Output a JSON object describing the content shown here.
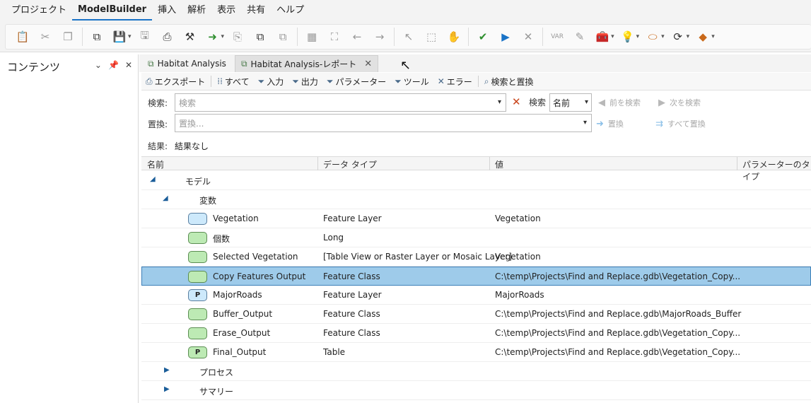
{
  "menu": {
    "items": [
      "プロジェクト",
      "ModelBuilder",
      "挿入",
      "解析",
      "表示",
      "共有",
      "ヘルプ"
    ],
    "active_index": 1
  },
  "ribbon": {
    "icons": [
      "paste-icon",
      "cut-icon",
      "copy-icon",
      "model-icon",
      "save-icon",
      "save-as-icon",
      "export-icon",
      "properties-icon",
      "tools-icon",
      "run-arrow-icon",
      "report-icon",
      "model-group-icon",
      "layout-icon",
      "auto-layout-icon",
      "fit-icon",
      "previous-icon",
      "next-icon",
      "select-icon",
      "select-all-icon",
      "pan-icon",
      "validate-icon",
      "run-icon",
      "stop-icon",
      "variable-icon",
      "edit-icon",
      "toolbox-icon",
      "lightbulb-icon",
      "label-icon",
      "iterator-icon",
      "utilities-icon"
    ]
  },
  "contents_panel": {
    "title": "コンテンツ"
  },
  "tabs": [
    {
      "label": "Habitat Analysis",
      "active": false
    },
    {
      "label": "Habitat Analysis-レポート",
      "active": true
    }
  ],
  "report_toolbar": {
    "export": "エクスポート",
    "all": "すべて",
    "input": "入力",
    "output": "出力",
    "parameter": "パラメーター",
    "tool": "ツール",
    "error": "エラー",
    "find_replace": "検索と置換"
  },
  "search": {
    "search_label": "検索:",
    "search_placeholder": "検索",
    "search_button": "検索",
    "search_by": "名前",
    "prev": "前を検索",
    "next": "次を検索",
    "replace_label": "置換:",
    "replace_placeholder": "置換...",
    "replace_button": "置換",
    "replace_all": "すべて置換",
    "result_label": "結果:",
    "result_value": "結果なし"
  },
  "grid": {
    "columns": [
      "名前",
      "データ タイプ",
      "値",
      "パラメーターのタイプ"
    ],
    "model_label": "モデル",
    "variables_label": "変数",
    "rows": [
      {
        "name": "Vegetation",
        "type": "Feature Layer",
        "value": "Vegetation",
        "badge": "",
        "color": "blue",
        "selected": false
      },
      {
        "name": "個数",
        "type": "Long",
        "value": "",
        "badge": "",
        "color": "green",
        "selected": false
      },
      {
        "name": "Selected Vegetation",
        "type": "[Table View or Raster Layer or Mosaic Layer]",
        "value": "Vegetation",
        "badge": "",
        "color": "green",
        "selected": false
      },
      {
        "name": "Copy Features Output",
        "type": "Feature Class",
        "value": "C:\\temp\\Projects\\Find and Replace.gdb\\Vegetation_Copy...",
        "badge": "",
        "color": "green",
        "selected": true
      },
      {
        "name": "MajorRoads",
        "type": "Feature Layer",
        "value": "MajorRoads",
        "badge": "P",
        "color": "blue",
        "selected": false
      },
      {
        "name": "Buffer_Output",
        "type": "Feature Class",
        "value": "C:\\temp\\Projects\\Find and Replace.gdb\\MajorRoads_Buffer",
        "badge": "",
        "color": "green",
        "selected": false
      },
      {
        "name": "Erase_Output",
        "type": "Feature Class",
        "value": "C:\\temp\\Projects\\Find and Replace.gdb\\Vegetation_Copy...",
        "badge": "",
        "color": "green",
        "selected": false
      },
      {
        "name": "Final_Output",
        "type": "Table",
        "value": "C:\\temp\\Projects\\Find and Replace.gdb\\Vegetation_Copy...",
        "badge": "P",
        "color": "green",
        "selected": false
      }
    ],
    "process_label": "プロセス",
    "summary_label": "サマリー"
  }
}
